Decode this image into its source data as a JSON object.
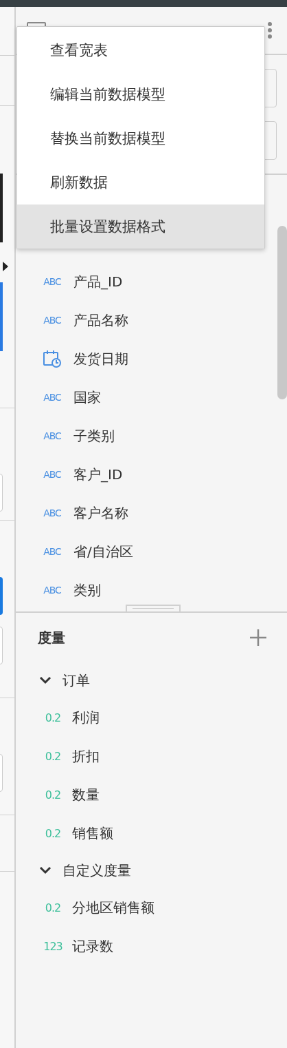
{
  "menu": {
    "items": [
      {
        "label": "查看宽表",
        "selected": false
      },
      {
        "label": "编辑当前数据模型",
        "selected": false
      },
      {
        "label": "替换当前数据模型",
        "selected": false
      },
      {
        "label": "刷新数据",
        "selected": false
      },
      {
        "label": "批量设置数据格式",
        "selected": true
      }
    ]
  },
  "dimensions": {
    "items": [
      {
        "kind": "text",
        "badge": "ABC",
        "label": "产品_ID"
      },
      {
        "kind": "text",
        "badge": "ABC",
        "label": "产品名称"
      },
      {
        "kind": "date",
        "label": "发货日期"
      },
      {
        "kind": "text",
        "badge": "ABC",
        "label": "国家"
      },
      {
        "kind": "text",
        "badge": "ABC",
        "label": "子类别"
      },
      {
        "kind": "text",
        "badge": "ABC",
        "label": "客户_ID"
      },
      {
        "kind": "text",
        "badge": "ABC",
        "label": "客户名称"
      },
      {
        "kind": "text",
        "badge": "ABC",
        "label": "省/自治区"
      },
      {
        "kind": "text",
        "badge": "ABC",
        "label": "类别"
      }
    ]
  },
  "measures": {
    "title": "度量",
    "groups": [
      {
        "label": "订单",
        "expanded": true,
        "children": [
          {
            "badge": "0.2",
            "label": "利润"
          },
          {
            "badge": "0.2",
            "label": "折扣"
          },
          {
            "badge": "0.2",
            "label": "数量"
          },
          {
            "badge": "0.2",
            "label": "销售额"
          }
        ]
      },
      {
        "label": "自定义度量",
        "expanded": true,
        "children": [
          {
            "badge": "0.2",
            "label": "分地区销售额"
          },
          {
            "badge": "123",
            "label": "记录数"
          }
        ]
      }
    ]
  }
}
